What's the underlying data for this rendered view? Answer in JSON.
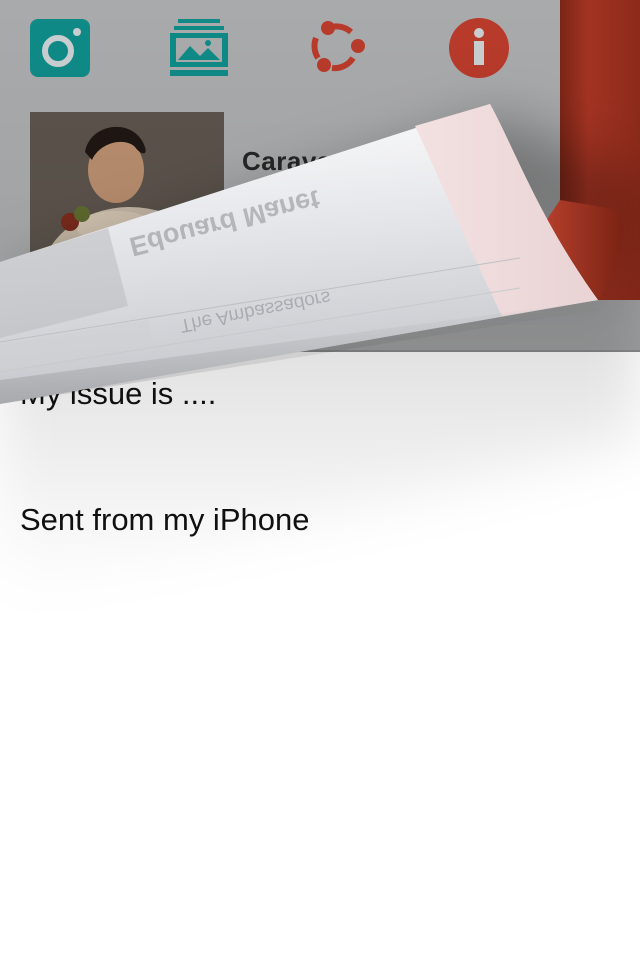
{
  "toolbar": {
    "icons": [
      {
        "name": "camera-icon",
        "color": "#0f8a87"
      },
      {
        "name": "gallery-icon",
        "color": "#0f8a87"
      },
      {
        "name": "share-icon",
        "color": "#b83a2a"
      },
      {
        "name": "info-icon",
        "color": "#b83a2a"
      }
    ]
  },
  "gallery": {
    "featured_artist": "Carava",
    "curl_back_title": "Edouard Manet",
    "curl_back_subtitle": "The Ambassadors"
  },
  "mail": {
    "body_line1": "My issue is ....",
    "signature": "Sent from my iPhone"
  },
  "colors": {
    "teal": "#0f8a87",
    "brand_red": "#b83a2a",
    "tab_red": "#8c2a1a"
  }
}
